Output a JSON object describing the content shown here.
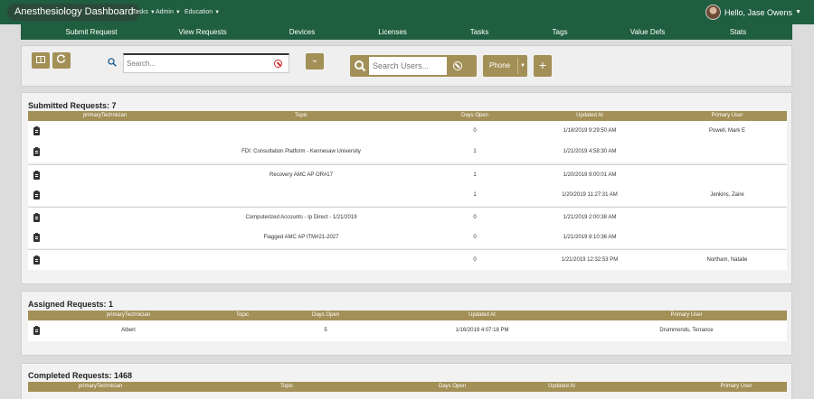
{
  "header": {
    "brand": "Anesthesiology Dashboard",
    "menus": [
      "Tasks",
      "Admin",
      "Education"
    ],
    "user_greeting": "Hello, Jase Owens"
  },
  "subnav": [
    "Submit Request",
    "View Requests",
    "Devices",
    "Licenses",
    "Tasks",
    "Tags",
    "Value Defs",
    "Stats"
  ],
  "toolbar": {
    "search_placeholder": "Search...",
    "user_search_placeholder": "Search Users...",
    "phone_label": "Phone",
    "plus_label": "+"
  },
  "submitted": {
    "title": "Submitted Requests: 7",
    "columns": [
      "primaryTechnician",
      "Topic",
      "Days Open",
      "Updated At",
      "Primary User"
    ],
    "rows": [
      {
        "technician": "",
        "topic": "",
        "days_open": "0",
        "updated_at": "1/18/2019 9:29:50 AM",
        "primary_user": "Powell, Mark E"
      },
      {
        "technician": "",
        "topic": "FDI: Consultation Platform - Kennesaw University",
        "days_open": "1",
        "updated_at": "1/21/2019 4:58:30 AM",
        "primary_user": ""
      },
      {
        "technician": "",
        "topic": "Recovery AMC AP OR#17",
        "days_open": "1",
        "updated_at": "1/20/2019 9:00:01 AM",
        "primary_user": ""
      },
      {
        "technician": "",
        "topic": "",
        "days_open": "1",
        "updated_at": "1/20/2019 11:27:31 AM",
        "primary_user": "Jenkins, Zaire"
      },
      {
        "technician": "",
        "topic": "Computerized Accounts - Ip Direct - 1/21/2019",
        "days_open": "0",
        "updated_at": "1/21/2019 2:00:38 AM",
        "primary_user": ""
      },
      {
        "technician": "",
        "topic": "Flagged AMC AP ITM#21-2027",
        "days_open": "0",
        "updated_at": "1/21/2019 8:10:36 AM",
        "primary_user": ""
      },
      {
        "technician": "",
        "topic": "",
        "days_open": "0",
        "updated_at": "1/21/2019 12:32:53 PM",
        "primary_user": "Northam, Natalie"
      }
    ]
  },
  "assigned": {
    "title": "Assigned Requests: 1",
    "columns": [
      "primaryTechnician",
      "Topic",
      "Days Open",
      "Updated At",
      "Primary User"
    ],
    "rows": [
      {
        "technician": "Albert",
        "topic": "",
        "days_open": "5",
        "updated_at": "1/16/2019 4:07:18 PM",
        "primary_user": "Drummonds, Terrance"
      }
    ]
  },
  "completed": {
    "title": "Completed Requests: 1468",
    "columns": [
      "primaryTechnician",
      "Topic",
      "Days Open",
      "Updated At",
      "Primary User"
    ]
  },
  "colors": {
    "green": "#1f5e3f",
    "gold": "#a39057"
  }
}
